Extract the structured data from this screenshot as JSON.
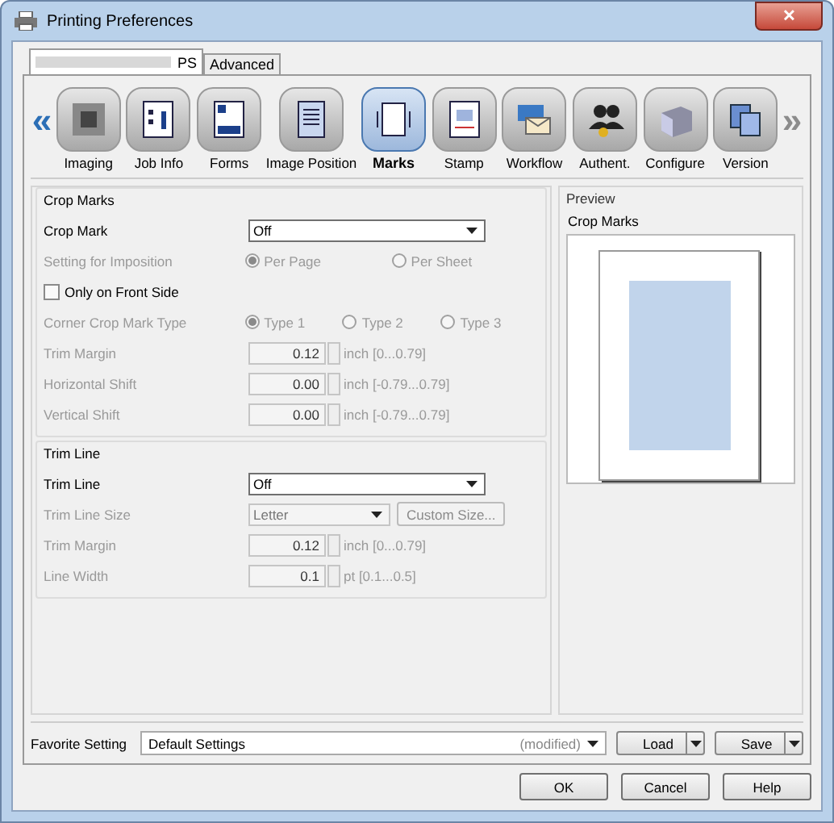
{
  "window": {
    "title": "Printing Preferences",
    "close": "✕"
  },
  "tabs": [
    {
      "label": "PS",
      "selected": true
    },
    {
      "label": "Advanced",
      "selected": false
    }
  ],
  "toolbar": {
    "prev": "«",
    "next": "»",
    "next_disabled": true,
    "items": [
      {
        "label": "Imaging",
        "selected": false
      },
      {
        "label": "Job Info",
        "selected": false
      },
      {
        "label": "Forms",
        "selected": false
      },
      {
        "label": "Image Position",
        "selected": false
      },
      {
        "label": "Marks",
        "selected": true
      },
      {
        "label": "Stamp",
        "selected": false
      },
      {
        "label": "Workflow",
        "selected": false
      },
      {
        "label": "Authent.",
        "selected": false
      },
      {
        "label": "Configure",
        "selected": false
      },
      {
        "label": "Version",
        "selected": false
      }
    ]
  },
  "sections": [
    {
      "title": "Crop Marks",
      "rows": [
        {
          "kind": "select",
          "label": "Crop Mark",
          "disabled": false,
          "value": "Off"
        },
        {
          "kind": "radio",
          "label": "Setting for Imposition",
          "disabled": true,
          "options": [
            {
              "label": "Per Page",
              "selected": true
            },
            {
              "label": "Per Sheet",
              "selected": false
            }
          ]
        },
        {
          "kind": "checkbox",
          "label": "Only on Front Side",
          "disabled": false,
          "checked": false
        },
        {
          "kind": "radio",
          "label": "Corner Crop Mark Type",
          "disabled": true,
          "options": [
            {
              "label": "Type 1",
              "selected": true
            },
            {
              "label": "Type 2",
              "selected": false
            },
            {
              "label": "Type 3",
              "selected": false
            }
          ]
        },
        {
          "kind": "spin",
          "label": "Trim Margin",
          "disabled": true,
          "value": "0.12",
          "unit": "inch [0...0.79]"
        },
        {
          "kind": "spin",
          "label": "Horizontal Shift",
          "disabled": true,
          "value": "0.00",
          "unit": "inch [-0.79...0.79]"
        },
        {
          "kind": "spin",
          "label": "Vertical Shift",
          "disabled": true,
          "value": "0.00",
          "unit": "inch [-0.79...0.79]"
        }
      ]
    },
    {
      "title": "Trim Line",
      "rows": [
        {
          "kind": "select",
          "label": "Trim Line",
          "disabled": false,
          "value": "Off"
        },
        {
          "kind": "select_button",
          "label": "Trim Line Size",
          "disabled": true,
          "value": "Letter",
          "button": "Custom Size..."
        },
        {
          "kind": "spin",
          "label": "Trim Margin",
          "disabled": true,
          "value": "0.12",
          "unit": "inch [0...0.79]"
        },
        {
          "kind": "spin",
          "label": "Line Width",
          "disabled": true,
          "value": "0.1",
          "unit": "pt [0.1...0.5]"
        }
      ]
    }
  ],
  "preview": {
    "title": "Preview",
    "caption": "Crop Marks"
  },
  "favorite": {
    "label": "Favorite Setting",
    "value": "Default Settings",
    "note": "(modified)",
    "buttons": [
      "Load",
      "Save"
    ]
  },
  "buttons": [
    "OK",
    "Cancel",
    "Help"
  ]
}
